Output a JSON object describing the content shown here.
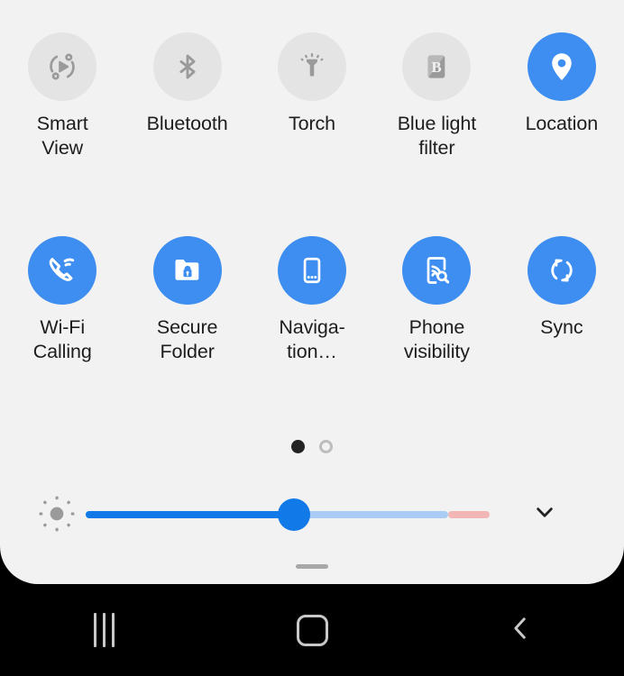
{
  "panel": {
    "name": "quick-settings-panel",
    "background": "#f2f2f2",
    "accent_on": "#3d8ef0",
    "accent_off": "#e4e4e4"
  },
  "tiles_row_1": [
    {
      "id": "smart-view",
      "label": "Smart\nView",
      "icon": "smart-view-icon",
      "state": "off"
    },
    {
      "id": "bluetooth",
      "label": "Bluetooth",
      "icon": "bluetooth-icon",
      "state": "off"
    },
    {
      "id": "torch",
      "label": "Torch",
      "icon": "torch-icon",
      "state": "off"
    },
    {
      "id": "blue-light-filter",
      "label": "Blue light\nfilter",
      "icon": "blue-light-filter-icon",
      "state": "off"
    },
    {
      "id": "location",
      "label": "Location",
      "icon": "location-pin-icon",
      "state": "on"
    }
  ],
  "tiles_row_2": [
    {
      "id": "wifi-calling",
      "label": "Wi-Fi\nCalling",
      "icon": "wifi-calling-icon",
      "state": "on"
    },
    {
      "id": "secure-folder",
      "label": "Secure\nFolder",
      "icon": "secure-folder-icon",
      "state": "on"
    },
    {
      "id": "navigation",
      "label": "Naviga-\ntion…",
      "icon": "navigation-bar-icon",
      "state": "on"
    },
    {
      "id": "phone-visibility",
      "label": "Phone\nvisibility",
      "icon": "phone-visibility-icon",
      "state": "on"
    },
    {
      "id": "sync",
      "label": "Sync",
      "icon": "sync-icon",
      "state": "on"
    }
  ],
  "page_indicator": {
    "name": "page-indicator",
    "total": 2,
    "current": 1
  },
  "brightness": {
    "name": "brightness-slider",
    "icon": "brightness-sun-icon",
    "value_percent": 51,
    "track_colors": {
      "fill": "#1279e8",
      "remaining": "#a9cdf5",
      "warning": "#f3b6b6"
    },
    "expand_icon": "chevron-down-icon"
  },
  "drag_handle": {
    "name": "panel-drag-handle"
  },
  "nav_bar": {
    "background": "#000000",
    "buttons": [
      {
        "id": "recents",
        "icon": "recents-icon"
      },
      {
        "id": "home",
        "icon": "home-icon"
      },
      {
        "id": "back",
        "icon": "back-chevron-icon"
      }
    ]
  }
}
